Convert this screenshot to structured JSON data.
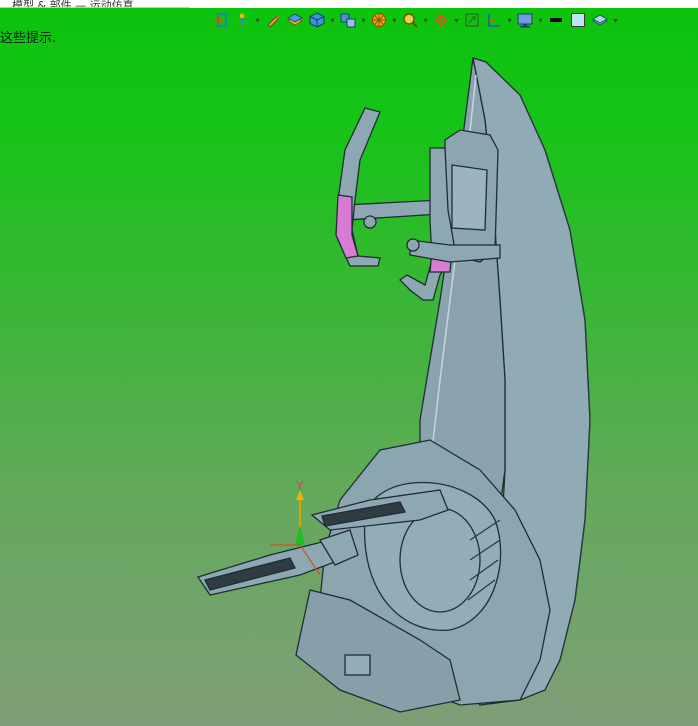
{
  "window": {
    "tab_title": "模型 & 部件 — 运动仿真"
  },
  "hint_text": "这些提示.",
  "toolbar": {
    "buttons": [
      {
        "icon": "export-icon",
        "has_dropdown": true
      },
      {
        "icon": "pin-icon",
        "has_dropdown": true
      },
      {
        "icon": "pencil-icon",
        "has_dropdown": false
      },
      {
        "icon": "layer-icon",
        "has_dropdown": false
      },
      {
        "icon": "cube-icon",
        "has_dropdown": true
      },
      {
        "icon": "views-icon",
        "has_dropdown": true
      },
      {
        "icon": "orientation-icon",
        "has_dropdown": true
      },
      {
        "icon": "zoom-icon",
        "has_dropdown": true
      },
      {
        "icon": "pan-rotate-icon",
        "has_dropdown": true
      },
      {
        "icon": "fit-view-icon",
        "has_dropdown": false
      },
      {
        "icon": "section-icon",
        "has_dropdown": true
      },
      {
        "icon": "display-icon",
        "has_dropdown": true
      },
      {
        "icon": "line-color-icon",
        "has_dropdown": false
      },
      {
        "icon": "background-swatch-icon",
        "has_dropdown": false
      },
      {
        "icon": "render-style-icon",
        "has_dropdown": true
      }
    ]
  },
  "axis": {
    "y_label": "Y"
  },
  "colors": {
    "background_top": "#0bc30b",
    "background_bottom": "#7f9e78",
    "model_fill": "#8ea8b3",
    "model_stroke": "#1f2d33",
    "highlight": "#d77bd4"
  }
}
